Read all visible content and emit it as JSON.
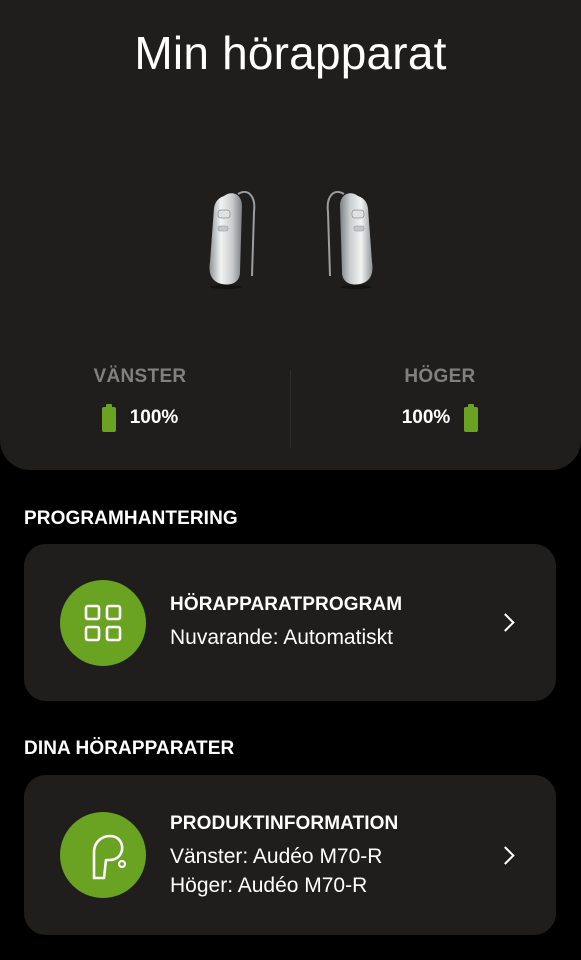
{
  "header": {
    "title": "Min hörapparat"
  },
  "devices": {
    "left": {
      "label": "VÄNSTER",
      "battery": "100%",
      "battery_level": 1.0
    },
    "right": {
      "label": "HÖGER",
      "battery": "100%",
      "battery_level": 1.0
    }
  },
  "sections": {
    "programs": {
      "heading": "PROGRAMHANTERING",
      "card": {
        "title": "HÖRAPPARATPROGRAM",
        "line1": "Nuvarande: Automatiskt",
        "icon": "grid-icon"
      }
    },
    "devices": {
      "heading": "DINA HÖRAPPARATER",
      "card": {
        "title": "PRODUKTINFORMATION",
        "line1": "Vänster: Audéo M70-R",
        "line2": "Höger: Audéo M70-R",
        "icon": "hearing-aid-icon"
      }
    }
  },
  "colors": {
    "accent": "#6aa321",
    "panel": "#1f1e1c",
    "background": "#000000",
    "muted_label": "#808080"
  }
}
